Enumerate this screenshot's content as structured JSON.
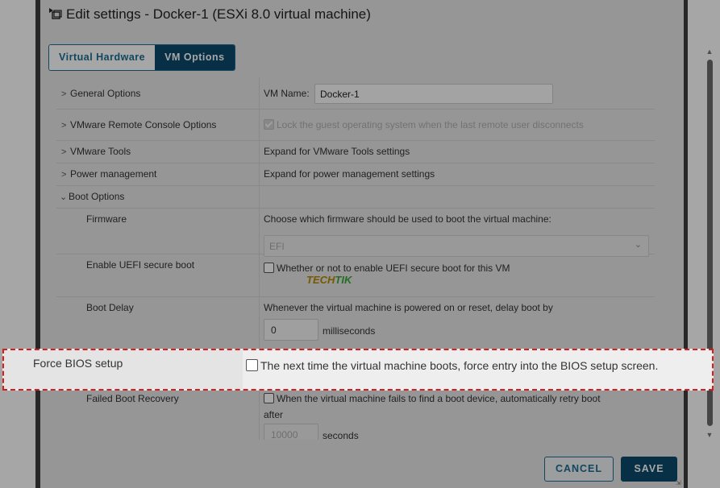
{
  "dialog": {
    "title": "Edit settings - Docker-1 (ESXi 8.0 virtual machine)",
    "tabs": [
      {
        "label": "Virtual Hardware",
        "active": false
      },
      {
        "label": "VM Options",
        "active": true
      }
    ]
  },
  "sections": {
    "general": {
      "label": "General Options",
      "vm_name_label": "VM Name:",
      "vm_name_value": "Docker-1"
    },
    "vmrc": {
      "label": "VMware Remote Console Options",
      "lock_text": "Lock the guest operating system when the last remote user disconnects"
    },
    "tools": {
      "label": "VMware Tools",
      "desc": "Expand for VMware Tools settings"
    },
    "power": {
      "label": "Power management",
      "desc": "Expand for power management settings"
    },
    "boot": {
      "label": "Boot Options"
    }
  },
  "boot_options": {
    "firmware": {
      "label": "Firmware",
      "desc": "Choose which firmware should be used to boot the virtual machine:",
      "selected": "EFI"
    },
    "uefi": {
      "label": "Enable UEFI secure boot",
      "desc": "Whether or not to enable UEFI secure boot for this VM"
    },
    "boot_delay": {
      "label": "Boot Delay",
      "desc": "Whenever the virtual machine is powered on or reset, delay boot by",
      "value": "0",
      "unit": "milliseconds"
    },
    "force_bios": {
      "label": "Force BIOS setup",
      "desc": "The next time the virtual machine boots, force entry into the BIOS setup screen."
    },
    "failed_recovery": {
      "label": "Failed Boot Recovery",
      "desc_line1": "When the virtual machine fails to find a boot device, automatically retry boot",
      "desc_line2": "after",
      "value": "10000",
      "unit": "seconds"
    }
  },
  "watermark": {
    "part1": "TECH",
    "part2": "TIK"
  },
  "footer": {
    "cancel": "CANCEL",
    "save": "SAVE"
  },
  "colors": {
    "accent": "#0b4a6e",
    "link": "#1b6e94",
    "highlight_border": "#d01f1f"
  }
}
